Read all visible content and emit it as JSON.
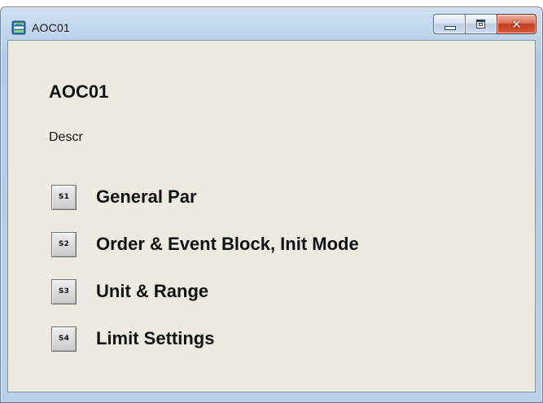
{
  "window": {
    "title": "AOC01",
    "icon": "app-window-icon",
    "close_glyph": "✕"
  },
  "content": {
    "heading": "AOC01",
    "description": "Descr",
    "sections": [
      {
        "button": "S1",
        "label": "General Par"
      },
      {
        "button": "S2",
        "label": "Order & Event Block, Init Mode"
      },
      {
        "button": "S3",
        "label": "Unit & Range"
      },
      {
        "button": "S4",
        "label": "Limit Settings"
      }
    ]
  },
  "colors": {
    "client_background": "#ecebe2",
    "close_button": "#c23f22",
    "title_bar": "#bcd3ea"
  }
}
